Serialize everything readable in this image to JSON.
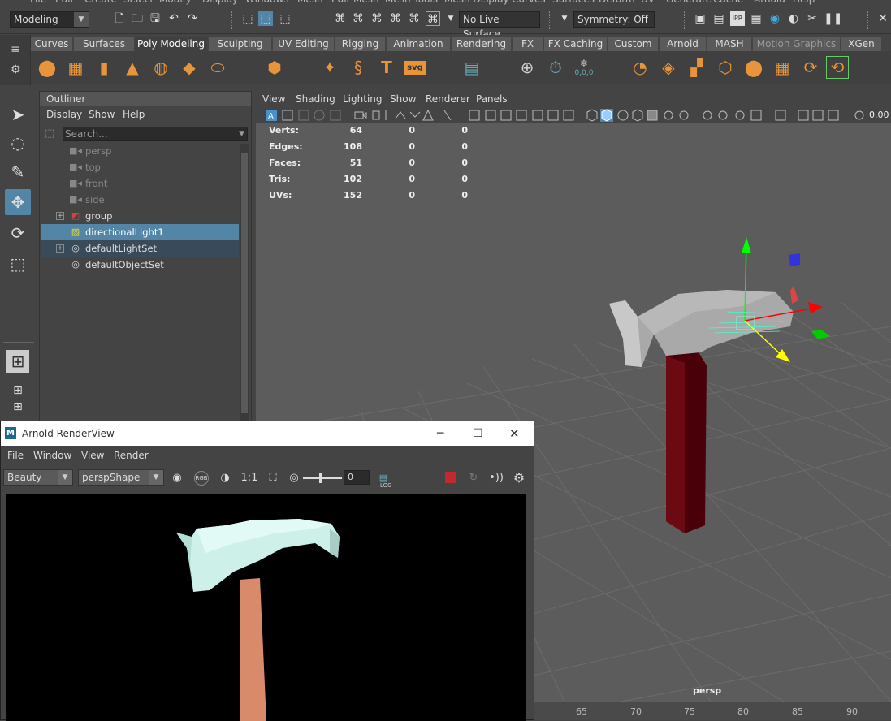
{
  "menubar": {
    "items": [
      "File",
      "Edit",
      "Create",
      "Select",
      "Modify",
      "Display",
      "Windows",
      "Mesh",
      "Edit Mesh",
      "Mesh Tools",
      "Mesh Display",
      "Curves",
      "Surfaces",
      "Deform",
      "UV",
      "Generate",
      "Cache",
      "Arnold",
      "Help"
    ]
  },
  "status": {
    "mode": "Modeling",
    "live_surface": "No Live Surface",
    "symmetry": "Symmetry: Off"
  },
  "shelf": {
    "tabs": [
      "Curves",
      "Surfaces",
      "Poly Modeling",
      "Sculpting",
      "UV Editing",
      "Rigging",
      "Animation",
      "Rendering",
      "FX",
      "FX Caching",
      "Custom",
      "Arnold",
      "MASH",
      "Motion Graphics",
      "XGen"
    ],
    "active_tab": "Poly Modeling",
    "svg_label": "svg",
    "coord_label": "0,0,0"
  },
  "outliner": {
    "title": "Outliner",
    "menu": [
      "Display",
      "Show",
      "Help"
    ],
    "search_placeholder": "Search...",
    "items": [
      {
        "label": "persp"
      },
      {
        "label": "top"
      },
      {
        "label": "front"
      },
      {
        "label": "side"
      },
      {
        "label": "group"
      },
      {
        "label": "directionalLight1"
      },
      {
        "label": "defaultLightSet"
      },
      {
        "label": "defaultObjectSet"
      }
    ]
  },
  "viewport": {
    "menu": [
      "View",
      "Shading",
      "Lighting",
      "Show",
      "Renderer",
      "Panels"
    ],
    "field_value": "0.00",
    "hud": [
      {
        "label": "Verts:",
        "v1": "64",
        "v2": "0",
        "v3": "0"
      },
      {
        "label": "Edges:",
        "v1": "108",
        "v2": "0",
        "v3": "0"
      },
      {
        "label": "Faces:",
        "v1": "51",
        "v2": "0",
        "v3": "0"
      },
      {
        "label": "Tris:",
        "v1": "102",
        "v2": "0",
        "v3": "0"
      },
      {
        "label": "UVs:",
        "v1": "152",
        "v2": "0",
        "v3": "0"
      }
    ],
    "camera": "persp"
  },
  "timeline": {
    "ticks": [
      "65",
      "70",
      "75",
      "80",
      "85",
      "90"
    ]
  },
  "renderview": {
    "title": "Arnold RenderView",
    "menu": [
      "File",
      "Window",
      "View",
      "Render"
    ],
    "aov": "Beauty",
    "camera": "perspShape",
    "ratio": "1:1",
    "exposure": "0",
    "rgb_label": "RGB",
    "log_label": "LOG"
  },
  "colors": {
    "accent": "#5285a6",
    "handle": "#6b0a12",
    "head": "#a9a9a9",
    "render_head": "#cdf1e9",
    "render_handle": "#d98a6a"
  }
}
